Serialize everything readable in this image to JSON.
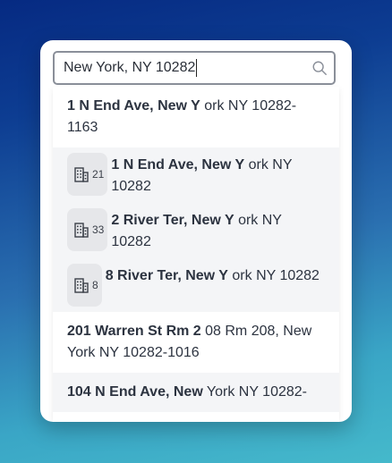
{
  "search": {
    "value": "New York, NY 10282",
    "icon": "search-icon"
  },
  "results": [
    {
      "bold": "1 N End Ave, New Y",
      "rest": " ork NY 10282-1163"
    },
    {
      "count": "21",
      "bold": "1 N End Ave, New Y",
      "rest": " ork NY 10282"
    },
    {
      "count": "33",
      "bold": "2 River Ter, New Y",
      "rest": " ork NY 10282"
    },
    {
      "count": "8",
      "bold": "8 River Ter, New Y",
      "rest": " ork NY 10282"
    },
    {
      "bold": "201 Warren St Rm 2",
      "rest": " 08 Rm 208, New York NY 10282-1016"
    },
    {
      "bold": "104 N End Ave, New",
      "rest": " York NY 10282-"
    }
  ],
  "colors": {
    "background_top": "#062a82",
    "background_bottom": "#45b9cb",
    "subrow_bg": "#f4f5f7",
    "pill_bg": "#e6e7ea"
  }
}
